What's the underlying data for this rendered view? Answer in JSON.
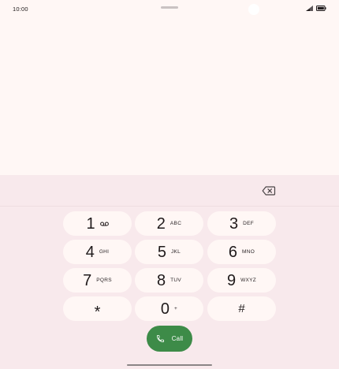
{
  "status_bar": {
    "time": "10:00",
    "icons": [
      "signal-icon",
      "battery-icon"
    ]
  },
  "dialer": {
    "number_value": "",
    "icons": [
      "backspace-icon",
      "voicemail-icon",
      "call-icon"
    ]
  },
  "keypad": {
    "keys": [
      {
        "digit": "1",
        "letters": ""
      },
      {
        "digit": "2",
        "letters": "ABC"
      },
      {
        "digit": "3",
        "letters": "DEF"
      },
      {
        "digit": "4",
        "letters": "GHI"
      },
      {
        "digit": "5",
        "letters": "JKL"
      },
      {
        "digit": "6",
        "letters": "MNO"
      },
      {
        "digit": "7",
        "letters": "PQRS"
      },
      {
        "digit": "8",
        "letters": "TUV"
      },
      {
        "digit": "9",
        "letters": "WXYZ"
      },
      {
        "digit": "*",
        "letters": ""
      },
      {
        "digit": "0",
        "letters": "+"
      },
      {
        "digit": "#",
        "letters": ""
      }
    ]
  },
  "call_button": {
    "label": "Call"
  },
  "colors": {
    "background": "#fff7f5",
    "keypad_panel": "#f8e9ec",
    "key_fill": "#fff7f5",
    "call_green": "#3d8b48"
  }
}
